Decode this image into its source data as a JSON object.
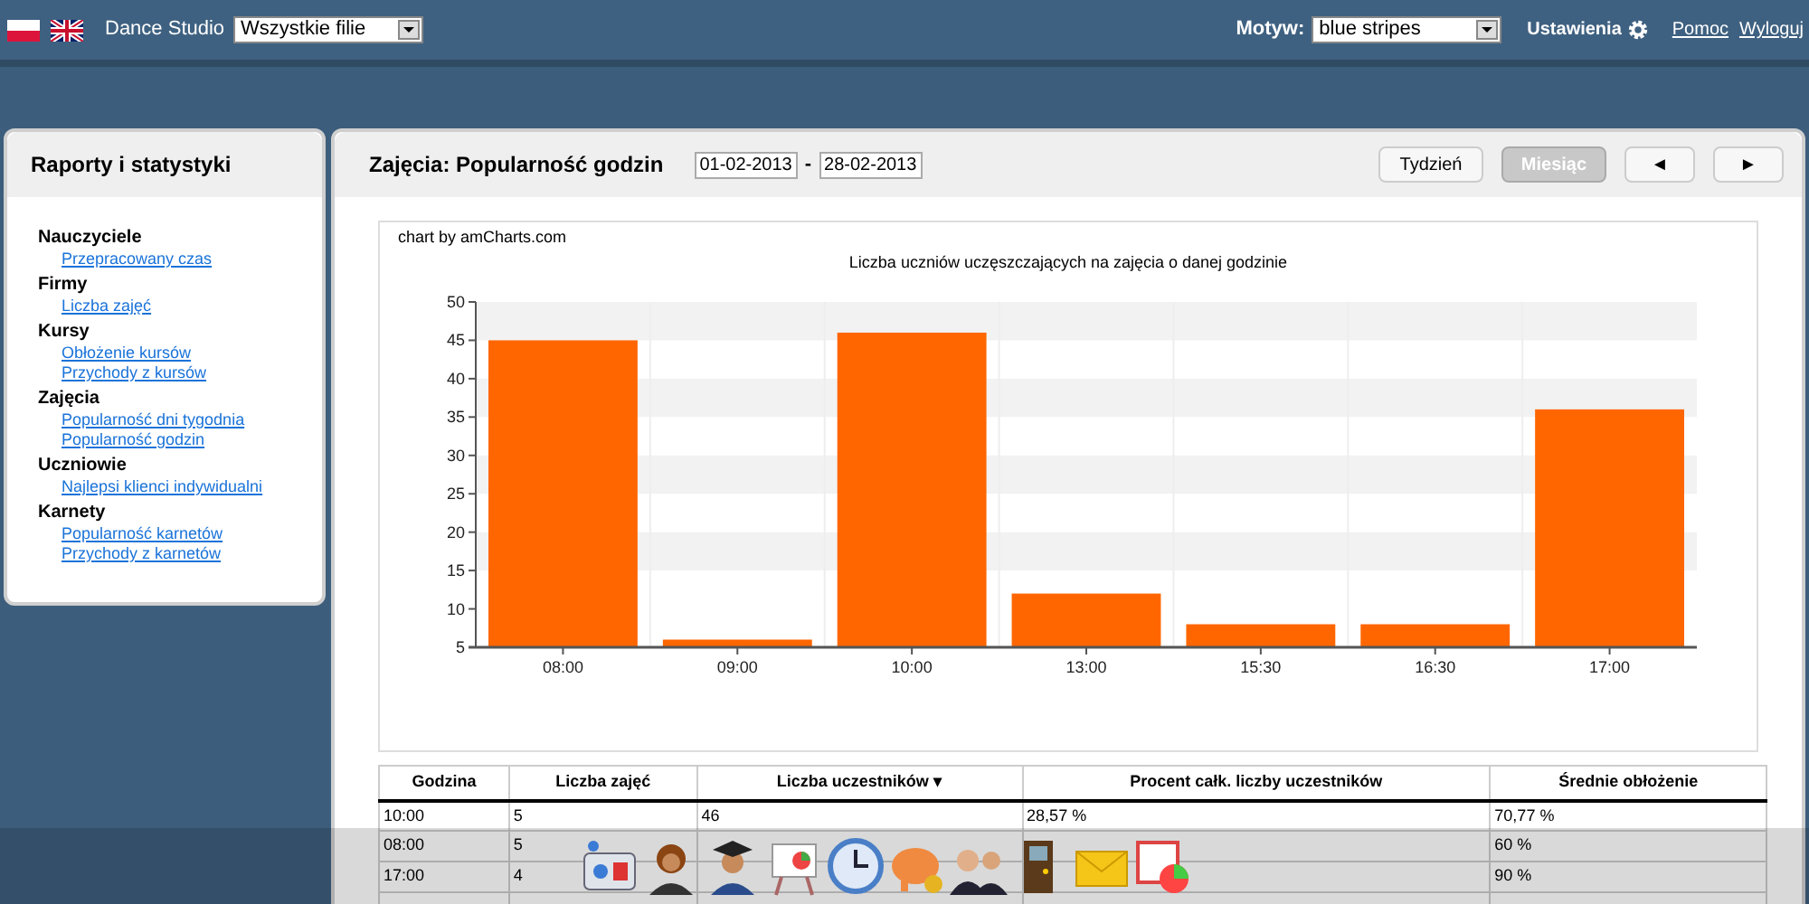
{
  "topbar": {
    "app_name": "Dance Studio",
    "branch_select": "Wszystkie filie",
    "theme_label": "Motyw:",
    "theme_select": "blue stripes",
    "settings": "Ustawienia",
    "links": [
      "Pomoc",
      "Wyloguj"
    ]
  },
  "sidebar": {
    "title": "Raporty i statystyki",
    "groups": [
      {
        "title": "Nauczyciele",
        "links": [
          "Przepracowany czas"
        ]
      },
      {
        "title": "Firmy",
        "links": [
          "Liczba zajęć"
        ]
      },
      {
        "title": "Kursy",
        "links": [
          "Obłożenie kursów",
          "Przychody z kursów"
        ]
      },
      {
        "title": "Zajęcia",
        "links": [
          "Popularność dni tygodnia",
          "Popularność godzin"
        ]
      },
      {
        "title": "Uczniowie",
        "links": [
          "Najlepsi klienci indywidualni"
        ]
      },
      {
        "title": "Karnety",
        "links": [
          "Popularność karnetów",
          "Przychody z karnetów"
        ]
      }
    ]
  },
  "report": {
    "title": "Zajęcia: Popularność godzin",
    "date_from": "01-02-2013",
    "date_to": "28-02-2013",
    "date_separator": "-",
    "range_buttons": [
      {
        "label": "Tydzień",
        "selected": false
      },
      {
        "label": "Miesiąc",
        "selected": true
      }
    ],
    "nav_buttons": [
      "◄",
      "►"
    ],
    "credit": "chart by amCharts.com",
    "chart_data": {
      "type": "bar",
      "title": "Liczba uczniów uczęszczających na zajęcia o danej godzinie",
      "categories": [
        "08:00",
        "09:00",
        "10:00",
        "13:00",
        "15:30",
        "16:30",
        "17:00"
      ],
      "series": [
        {
          "color": "#ff6600",
          "values": [
            45,
            6,
            46,
            12,
            8,
            8,
            36
          ]
        }
      ],
      "ylim": [
        5,
        50
      ],
      "yticks": [
        5,
        10,
        15,
        20,
        25,
        30,
        35,
        40,
        45,
        50
      ]
    },
    "table": {
      "columns": [
        "Godzina",
        "Liczba zajęć",
        "Liczba uczestników ▾",
        "Procent całk. liczby uczestników",
        "Średnie obłożenie"
      ],
      "rows": [
        [
          "10:00",
          "5",
          "46",
          "28,57 %",
          "70,77 %"
        ],
        [
          "08:00",
          "5",
          null,
          null,
          "60 %"
        ],
        [
          "17:00",
          "4",
          null,
          null,
          "90 %"
        ]
      ]
    }
  }
}
